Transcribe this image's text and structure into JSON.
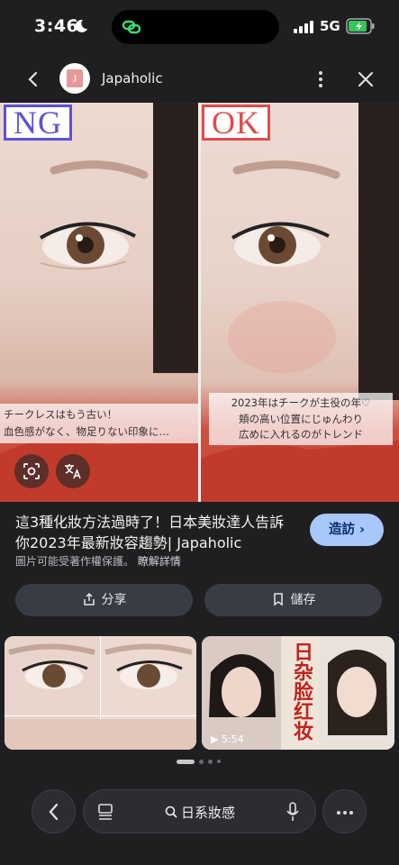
{
  "status": {
    "time": "3:46",
    "network": "5G"
  },
  "header": {
    "site_name": "Japaholic",
    "avatar_letter": "J"
  },
  "image": {
    "ng_label": "NG",
    "ok_label": "OK",
    "ng_caption": [
      "チークレスはもう古い！",
      "血色感がなく、物足りない印象に…"
    ],
    "ok_caption": [
      "2023年はチークが主役の年♡",
      "頬の高い位置にじゅんわり",
      "広めに入れるのがトレンド"
    ]
  },
  "result": {
    "title": "這3種化妝方法過時了！日本美妝達人告訴你2023年最新妝容趨勢| Japaholic",
    "visit_label": "造訪",
    "copyright_note": "圖片可能受著作權保護。",
    "learn_more": "瞭解詳情"
  },
  "actions": {
    "share_label": "分享",
    "save_label": "儲存"
  },
  "related": {
    "thumb2_title": "日杂脸红妆",
    "thumb2_duration": "5:54"
  },
  "bottom_bar": {
    "search_query": "日系妝感"
  }
}
